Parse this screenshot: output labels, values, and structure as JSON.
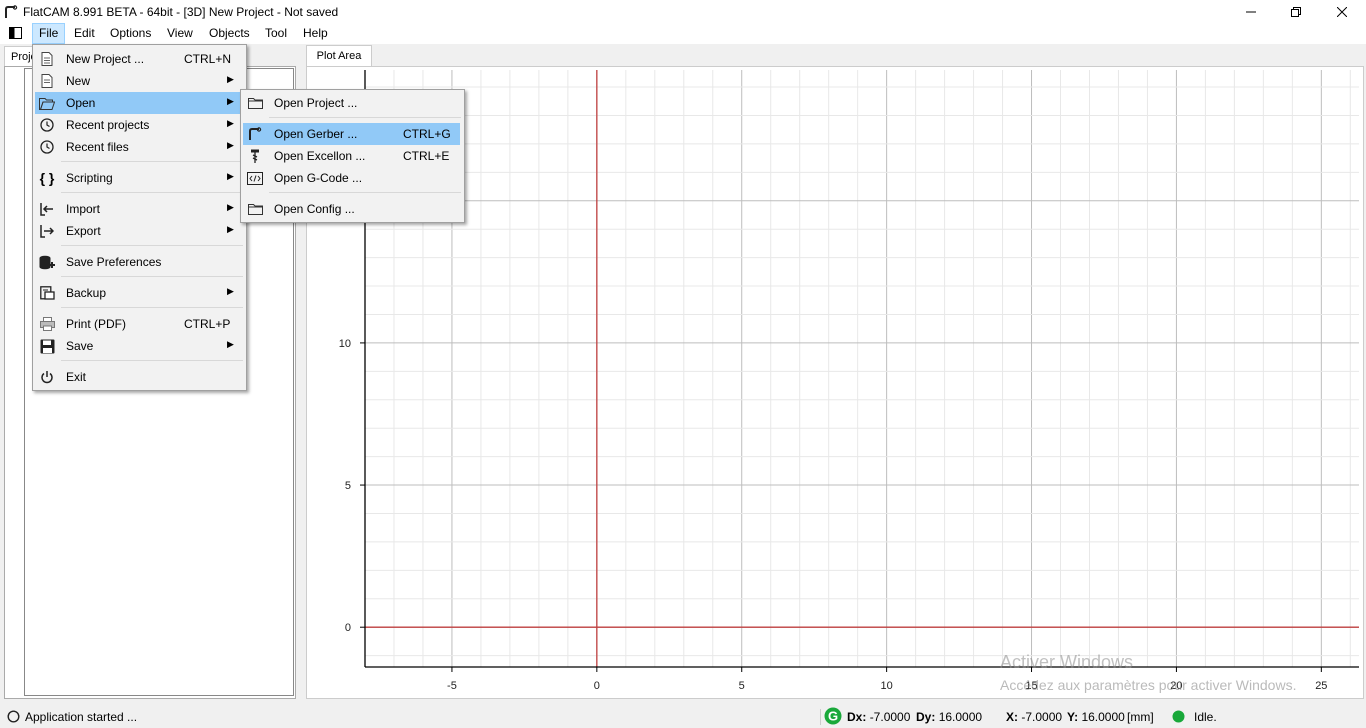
{
  "window": {
    "title": "FlatCAM 8.991 BETA - 64bit - [3D]    New Project - Not saved"
  },
  "menubar": {
    "items": [
      "File",
      "Edit",
      "Options",
      "View",
      "Objects",
      "Tool",
      "Help"
    ],
    "active": "File"
  },
  "tabs": {
    "left": "Project",
    "plot": "Plot Area"
  },
  "file_menu": {
    "items": [
      {
        "label": "New Project ...",
        "shortcut": "CTRL+N",
        "icon": "document-icon"
      },
      {
        "label": "New",
        "submenu": true,
        "icon": "document-icon"
      },
      {
        "label": "Open",
        "submenu": true,
        "icon": "folder-open-icon",
        "highlighted": true
      },
      {
        "label": "Recent projects",
        "submenu": true,
        "icon": "clock-icon"
      },
      {
        "label": "Recent files",
        "submenu": true,
        "icon": "clock-icon"
      },
      {
        "label": "Scripting",
        "submenu": true,
        "icon": "braces-icon"
      },
      {
        "label": "Import",
        "submenu": true,
        "icon": "import-icon"
      },
      {
        "label": "Export",
        "submenu": true,
        "icon": "export-icon"
      },
      {
        "label": "Save Preferences",
        "icon": "database-icon"
      },
      {
        "label": "Backup",
        "submenu": true,
        "icon": "backup-icon"
      },
      {
        "label": "Print (PDF)",
        "shortcut": "CTRL+P",
        "icon": "printer-icon"
      },
      {
        "label": "Save",
        "submenu": true,
        "icon": "floppy-icon"
      },
      {
        "label": "Exit",
        "icon": "power-icon"
      }
    ]
  },
  "open_submenu": {
    "items": [
      {
        "label": "Open Project ...",
        "icon": "folder-icon"
      },
      {
        "label": "Open Gerber ...",
        "shortcut": "CTRL+G",
        "icon": "gerber-icon",
        "highlighted": true
      },
      {
        "label": "Open Excellon ...",
        "shortcut": "CTRL+E",
        "icon": "drill-icon"
      },
      {
        "label": "Open G-Code ...",
        "icon": "code-icon"
      },
      {
        "label": "Open Config ...",
        "icon": "folder-icon"
      }
    ]
  },
  "plot": {
    "x_ticks": [
      "-5",
      "0",
      "5",
      "10",
      "15",
      "20",
      "25"
    ],
    "y_ticks": [
      "0",
      "5",
      "10"
    ],
    "x_range": [
      -8,
      26.3
    ],
    "y_range": [
      -1.4,
      19.6
    ],
    "axis_color": "#c04040"
  },
  "statusbar": {
    "message": "Application started ...",
    "dx_label": "Dx:",
    "dx_value": "-7.0000",
    "dy_label": "Dy:",
    "dy_value": "16.0000",
    "x_label": "X:",
    "x_value": "-7.0000",
    "y_label": "Y:",
    "y_value": "16.0000",
    "units": "[mm]",
    "state": "Idle."
  },
  "watermark": {
    "line1": "Activer Windows",
    "line2": "Accédez aux paramètres pour activer Windows."
  }
}
